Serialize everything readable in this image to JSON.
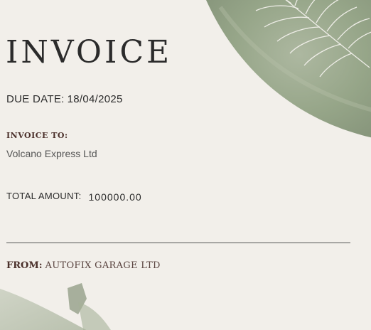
{
  "invoice": {
    "title": "INVOICE",
    "due_date_label": "DUE DATE:",
    "due_date_value": "18/04/2025",
    "invoice_to_label": "INVOICE TO:",
    "invoice_to_value": "Volcano Express Ltd",
    "total_label": "TOTAL AMOUNT:",
    "total_value": "100000.00",
    "from_label": "FROM:",
    "from_value": "AUTOFIX GARAGE LTD"
  },
  "colors": {
    "background": "#f2efea",
    "leaf_green": "#8e9f80",
    "heading_brown": "#4a2f2a",
    "text": "#2b2b2b"
  },
  "decorations": [
    "watercolor-leaf-top-right",
    "line-art-fern",
    "watercolor-leaf-bottom-left"
  ]
}
